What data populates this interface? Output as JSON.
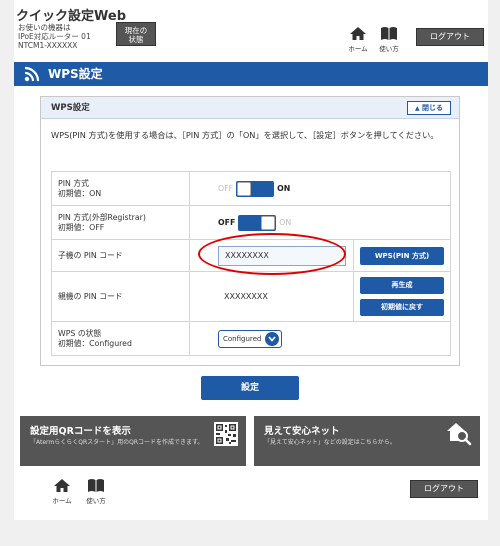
{
  "header": {
    "title": "クイック設定Web",
    "device_lines": [
      "お使いの機器は",
      "IPoE対応ルーター 01",
      "NTCM1-XXXXXX"
    ],
    "status_button": [
      "現在の",
      "状態"
    ],
    "home_label": "ホーム",
    "howto_label": "使い方",
    "logout_label": "ログアウト"
  },
  "section": {
    "title": "WPS設定"
  },
  "panel": {
    "title": "WPS設定",
    "close_label": "閉じる",
    "description": "WPS(PIN 方式)を使用する場合は、［PIN 方式］の「ON」を選択して、［設定］ボタンを押してください。",
    "rows": {
      "pin_method": {
        "label": "PIN 方式",
        "default": "初期値：ON",
        "off": "OFF",
        "on": "ON"
      },
      "pin_external": {
        "label": "PIN 方式(外部Registrar)",
        "default": "初期値：OFF",
        "off": "OFF",
        "on": "ON"
      },
      "child_pin": {
        "label": "子機の PIN コード",
        "value": "XXXXXXXX",
        "button": "WPS(PIN 方式)"
      },
      "parent_pin": {
        "label": "親機の PIN コード",
        "value": "XXXXXXXX",
        "regenerate": "再生成",
        "reset": "初期値に戻す"
      },
      "wps_state": {
        "label": "WPS の状態",
        "default": "初期値：Configured",
        "selected": "Configured"
      }
    }
  },
  "apply_label": "設定",
  "tiles": {
    "qr": {
      "title": "設定用QRコードを表示",
      "desc": "「AtermらくらくQRスタート」用のQRコードを作成できます。"
    },
    "safe": {
      "title": "見えて安心ネット",
      "desc": "「見えて安心ネット」などの設定はこちらから。"
    }
  },
  "footer": {
    "home_label": "ホーム",
    "howto_label": "使い方",
    "logout_label": "ログアウト"
  },
  "colors": {
    "accent": "#1f5aa6",
    "dark_button": "#555555",
    "highlight": "#e00000"
  }
}
